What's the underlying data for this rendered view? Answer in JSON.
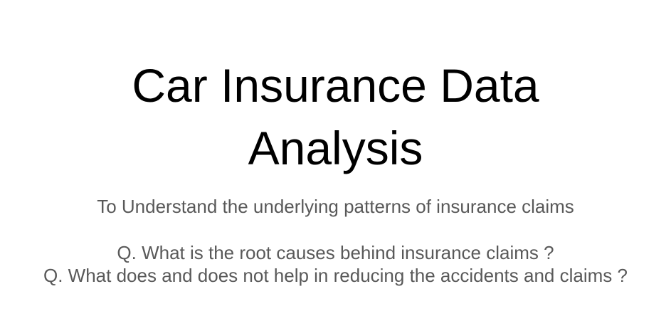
{
  "slide": {
    "title_lines": [
      "Car Insurance Data",
      "Analysis"
    ],
    "subtitle": "To Understand the underlying patterns of insurance claims",
    "questions": [
      "Q. What is the root causes behind insurance claims ?",
      "Q. What does and does not help in reducing the accidents and claims ?"
    ]
  },
  "colors": {
    "background": "#ffffff",
    "title": "#000000",
    "body_text": "#595959"
  }
}
